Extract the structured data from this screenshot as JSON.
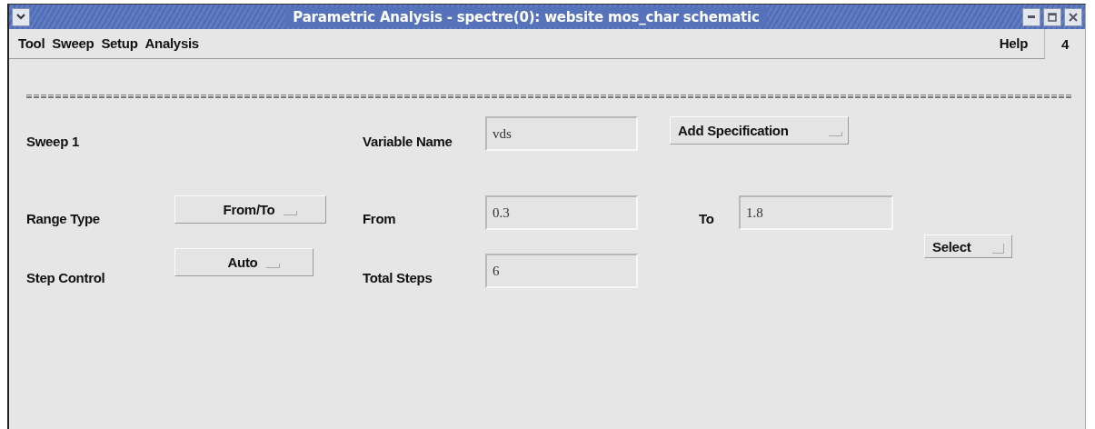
{
  "window": {
    "title": "Parametric Analysis - spectre(0): website mos_char schematic"
  },
  "menu": [
    {
      "label": "Tool"
    },
    {
      "label": "Sweep"
    },
    {
      "label": "Setup"
    },
    {
      "label": "Analysis"
    }
  ],
  "help_menu": "Help",
  "column_1": "4",
  "sweep": {
    "label": "Sweep 1",
    "variable_name": {
      "label": "Variable Name",
      "value": "vds"
    },
    "add_specification": "Add Specification",
    "range_type": {
      "label": "Range Type",
      "value": "From/To"
    },
    "from": {
      "label": "From",
      "value": "0.3"
    },
    "to": {
      "label": "To",
      "value": "1.8"
    },
    "select": "Select",
    "step_control": {
      "label": "Step Control",
      "value": "Auto"
    },
    "total_steps": {
      "label": "Total Steps",
      "value": "6"
    }
  }
}
